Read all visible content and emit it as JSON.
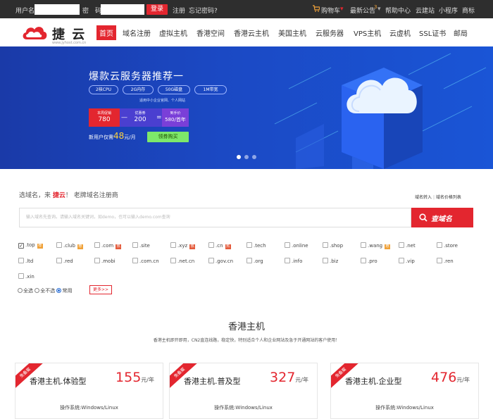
{
  "topbar": {
    "username_label": "用户名:",
    "password_label": "密　码:",
    "login_label": "登录",
    "register_label": "注册",
    "forgot_label": "忘记密码?",
    "cart_label": "购物车",
    "notice_label": "最新公告",
    "notice_count": "3",
    "help_label": "帮助中心",
    "site_label": "云建站",
    "miniapp_label": "小程序",
    "trademark_label": "商标"
  },
  "brand": {
    "name": "捷 云",
    "url": "www.jyhost.com.cn"
  },
  "nav": {
    "items": [
      {
        "label": "首页"
      },
      {
        "label": "域名注册"
      },
      {
        "label": "虚拟主机"
      },
      {
        "label": "香港空间"
      },
      {
        "label": "香港云主机"
      },
      {
        "label": "美国主机"
      },
      {
        "label": "云服务器"
      },
      {
        "label": "VPS主机"
      },
      {
        "label": "云虚机"
      },
      {
        "label": "SSL证书"
      },
      {
        "label": "邮局"
      }
    ]
  },
  "banner": {
    "title": "爆款云服务器推荐一",
    "specs": [
      "2核CPU",
      "2G内存",
      "50G磁盘",
      "1M带宽"
    ],
    "note": "适用中小企业官网、个人网站",
    "promo": {
      "part1_l1": "本周促销",
      "part1_l2": "780",
      "op1": "—",
      "part2_l1": "优惠券",
      "part2_l2": "200",
      "op2": "=",
      "part3_l1": "到手价",
      "part3_l2": "580/首年"
    },
    "price_prefix": "新用户仅需",
    "price_value": "48",
    "price_suffix": "元/月",
    "buy_label": "领券购买",
    "active_dot": 0
  },
  "search": {
    "title_prefix": "选域名，来 ",
    "title_brand": "捷云",
    "title_suffix": "！ 老牌域名注册商",
    "link_transfer": "域名转入",
    "link_price": "域名价格列表",
    "placeholder": "输入域名先查询。请输入域名关键词，如demo，也可以输入demo.com查询",
    "button_label": "查域名",
    "tlds_row1": [
      {
        "name": ".top",
        "checked": true,
        "tag": "rec"
      },
      {
        "name": ".club",
        "checked": false,
        "tag": "rec"
      },
      {
        "name": ".com",
        "checked": false,
        "tag": "hot"
      },
      {
        "name": ".site",
        "checked": false,
        "tag": ""
      },
      {
        "name": ".xyz",
        "checked": false,
        "tag": "hot"
      },
      {
        "name": ".cn",
        "checked": false,
        "tag": "hot"
      },
      {
        "name": ".tech",
        "checked": false,
        "tag": ""
      },
      {
        "name": ".online",
        "checked": false,
        "tag": ""
      },
      {
        "name": ".shop",
        "checked": false,
        "tag": ""
      },
      {
        "name": ".wang",
        "checked": false,
        "tag": "rec"
      },
      {
        "name": ".net",
        "checked": false,
        "tag": ""
      },
      {
        "name": ".store",
        "checked": false,
        "tag": ""
      }
    ],
    "tlds_row2": [
      {
        "name": ".ltd"
      },
      {
        "name": ".red"
      },
      {
        "name": ".mobi"
      },
      {
        "name": ".com.cn"
      },
      {
        "name": ".net.cn"
      },
      {
        "name": ".gov.cn"
      },
      {
        "name": ".org"
      },
      {
        "name": ".info"
      },
      {
        "name": ".biz"
      },
      {
        "name": ".pro"
      },
      {
        "name": ".vip"
      },
      {
        "name": ".ren"
      }
    ],
    "tlds_row3": [
      {
        "name": ".xin"
      }
    ],
    "radio_all": "全选",
    "radio_none": "全不选",
    "radio_common": "常用",
    "more_label": "更多>>"
  },
  "hosting": {
    "title": "香港主机",
    "desc": "香港主机即开即用，CN2直连线路，稳定快，特别适合个人和企业网站及急于开通网站的客户使用！",
    "cards": [
      {
        "ribbon": "免备案",
        "name": "香港主机.体验型",
        "price": "155",
        "unit": "元/年",
        "os": "操作系统:Windows/Linux"
      },
      {
        "ribbon": "免备案",
        "name": "香港主机.普及型",
        "price": "327",
        "unit": "元/年",
        "os": "操作系统:Windows/Linux"
      },
      {
        "ribbon": "免备案",
        "name": "香港主机.企业型",
        "price": "476",
        "unit": "元/年",
        "os": "操作系统:Windows/Linux"
      }
    ]
  },
  "colors": {
    "accent": "#e3262f",
    "banner": "#1b49c4",
    "topbar": "#2e2e2e"
  }
}
